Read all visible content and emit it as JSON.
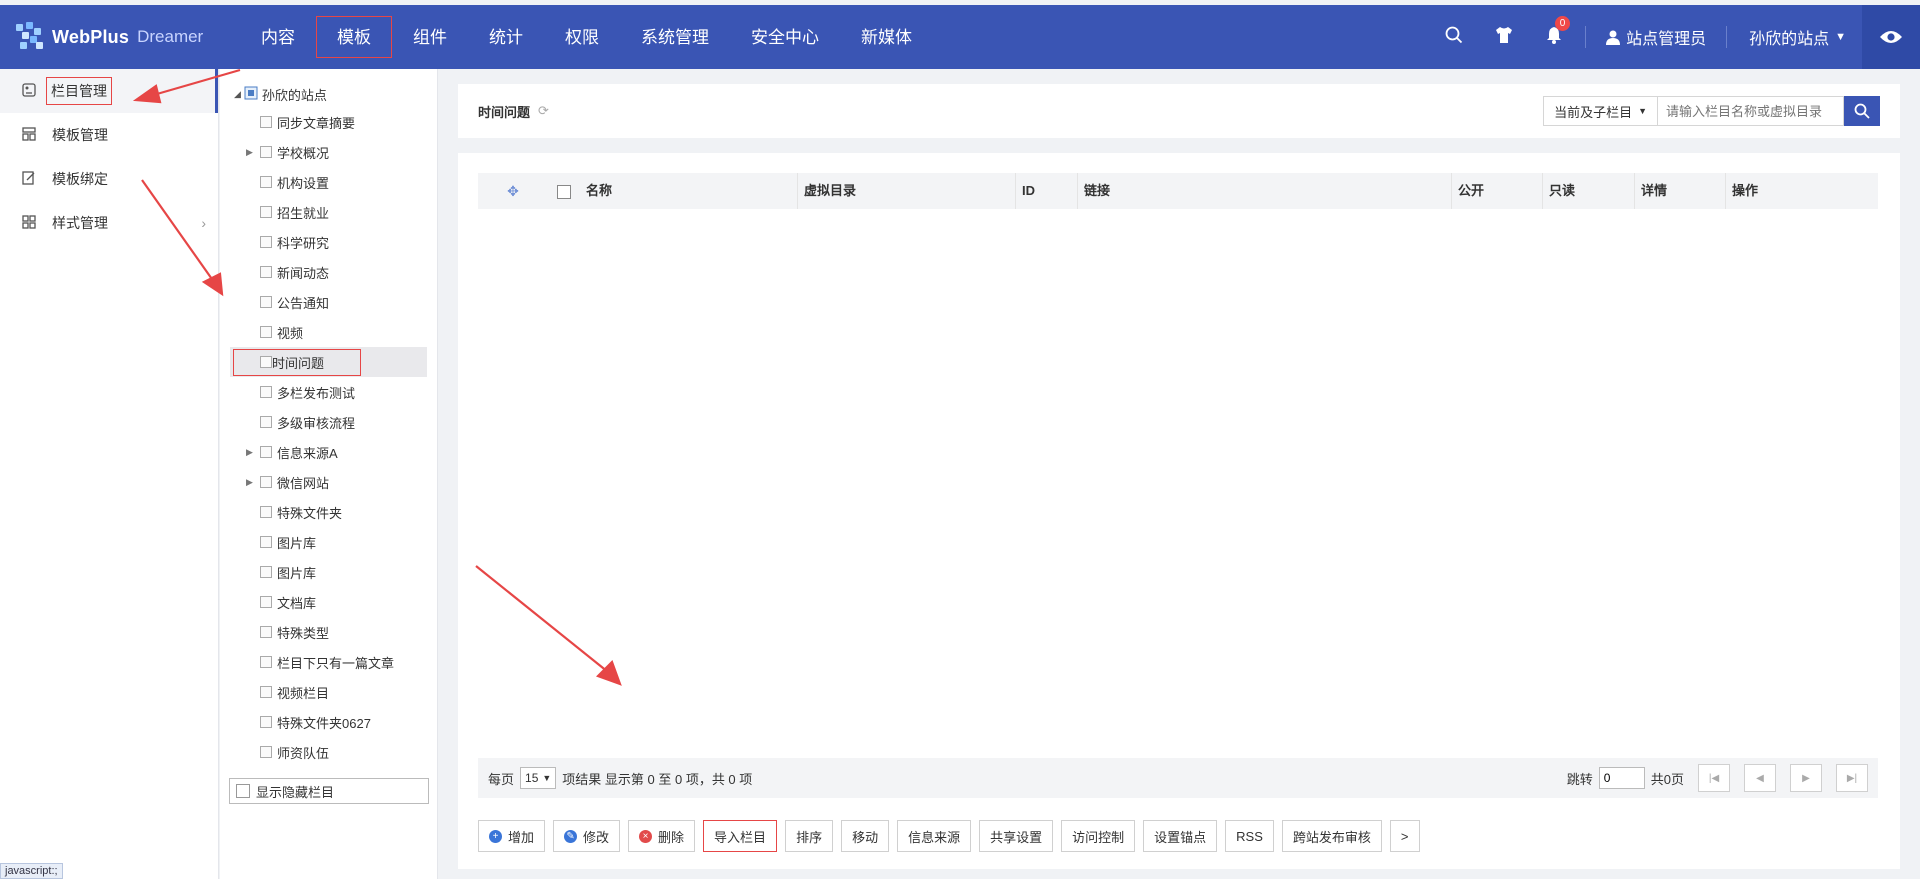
{
  "header": {
    "logo_text": "WebPlus",
    "logo_sub": "Dreamer",
    "nav": [
      "内容",
      "模板",
      "组件",
      "统计",
      "权限",
      "系统管理",
      "安全中心",
      "新媒体"
    ],
    "notification_count": "0",
    "user": "站点管理员",
    "site": "孙欣的站点"
  },
  "sidebar": {
    "items": [
      {
        "label": "栏目管理",
        "icon": "column-icon"
      },
      {
        "label": "模板管理",
        "icon": "template-icon"
      },
      {
        "label": "模板绑定",
        "icon": "bind-icon"
      },
      {
        "label": "样式管理",
        "icon": "style-icon"
      }
    ],
    "status": "javascript:;"
  },
  "tree": {
    "root": "孙欣的站点",
    "nodes": [
      "同步文章摘要",
      "学校概况",
      "机构设置",
      "招生就业",
      "科学研究",
      "新闻动态",
      "公告通知",
      "视频",
      "时间问题",
      "多栏发布测试",
      "多级审核流程",
      "信息来源A",
      "微信网站",
      "特殊文件夹",
      "图片库",
      "图片库",
      "文档库",
      "特殊类型",
      "栏目下只有一篇文章",
      "视频栏目",
      "特殊文件夹0627",
      "师资队伍"
    ],
    "show_hidden": "显示隐藏栏目"
  },
  "main": {
    "title": "时间问题",
    "scope": "当前及子栏目",
    "search_placeholder": "请输入栏目名称或虚拟目录",
    "columns": [
      "名称",
      "虚拟目录",
      "ID",
      "链接",
      "公开",
      "只读",
      "详情",
      "操作"
    ],
    "pager": {
      "per_page_label": "每页",
      "per_page": "15",
      "summary": "项结果 显示第 0 至 0 项，共 0 项",
      "jump_label": "跳转",
      "jump_value": "0",
      "total_pages": "共0页"
    },
    "actions": [
      "增加",
      "修改",
      "删除",
      "导入栏目",
      "排序",
      "移动",
      "信息来源",
      "共享设置",
      "访问控制",
      "设置锚点",
      "RSS",
      "跨站发布审核",
      ">"
    ]
  },
  "colors": {
    "nav_bg": "#3a55b4",
    "annotation_red": "#e64646"
  }
}
